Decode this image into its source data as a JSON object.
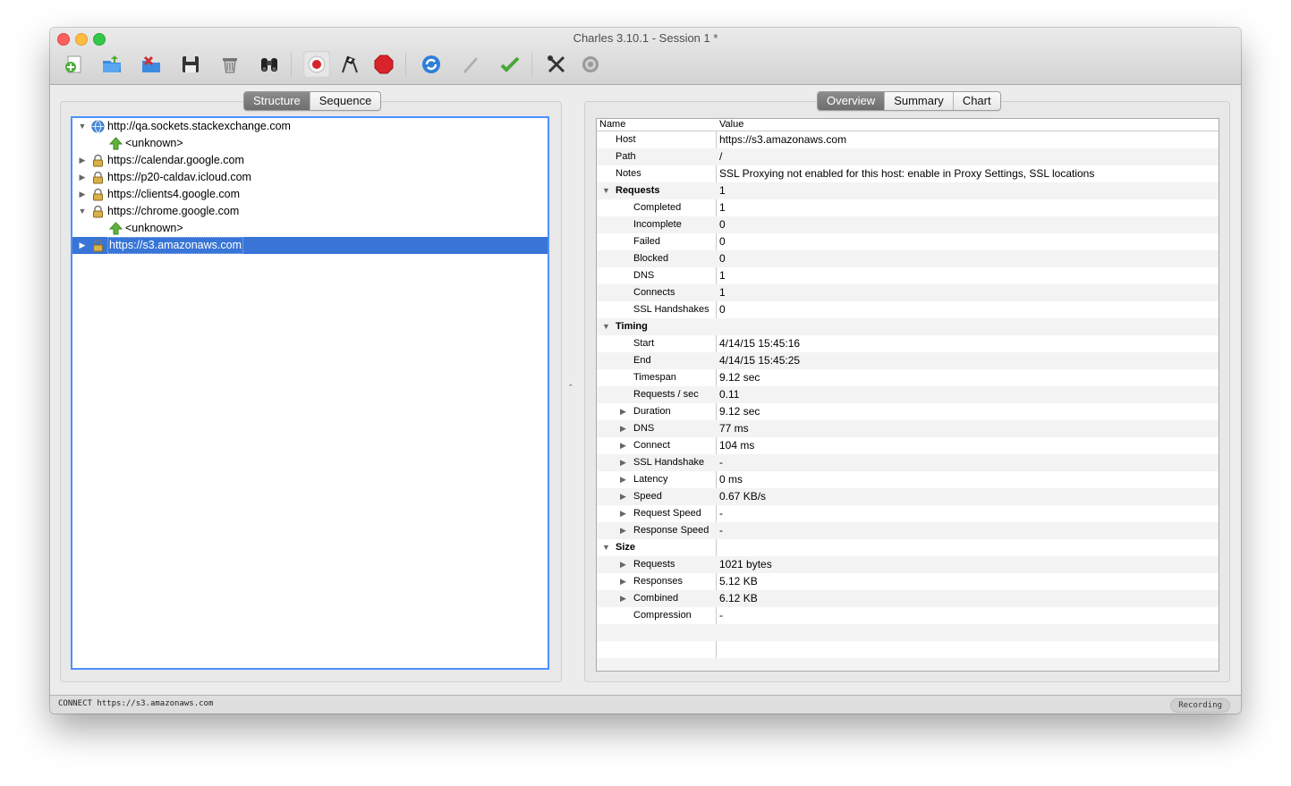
{
  "window": {
    "title": "Charles 3.10.1 - Session 1 *"
  },
  "toolbar": {
    "buttons": [
      {
        "name": "new-session",
        "icon": "new-session-icon"
      },
      {
        "name": "open-session",
        "icon": "open-folder-icon"
      },
      {
        "name": "close-session",
        "icon": "close-session-icon"
      },
      {
        "name": "save",
        "icon": "floppy-disk-icon"
      },
      {
        "name": "clear",
        "icon": "trash-icon"
      },
      {
        "name": "find",
        "icon": "binoculars-icon"
      },
      {
        "name": "record",
        "icon": "record-icon"
      },
      {
        "name": "throttle",
        "icon": "checkered-flags-icon"
      },
      {
        "name": "breakpoints",
        "icon": "stop-sign-icon"
      },
      {
        "name": "repeat",
        "icon": "refresh-icon"
      },
      {
        "name": "edit",
        "icon": "pencil-icon"
      },
      {
        "name": "validate",
        "icon": "checkmark-icon"
      },
      {
        "name": "tools",
        "icon": "tools-icon"
      },
      {
        "name": "settings",
        "icon": "gear-icon"
      }
    ]
  },
  "left_tabs": [
    {
      "label": "Structure",
      "selected": true
    },
    {
      "label": "Sequence",
      "selected": false
    }
  ],
  "right_tabs": [
    {
      "label": "Overview",
      "selected": true
    },
    {
      "label": "Summary",
      "selected": false
    },
    {
      "label": "Chart",
      "selected": false
    }
  ],
  "tree": [
    {
      "label": "http://qa.sockets.stackexchange.com",
      "icon": "globe-icon",
      "expanded": true,
      "level": 0
    },
    {
      "label": "<unknown>",
      "icon": "upload-arrow-icon",
      "level": 1
    },
    {
      "label": "https://calendar.google.com",
      "icon": "lock-icon",
      "expanded": false,
      "level": 0
    },
    {
      "label": "https://p20-caldav.icloud.com",
      "icon": "lock-icon",
      "expanded": false,
      "level": 0
    },
    {
      "label": "https://clients4.google.com",
      "icon": "lock-icon",
      "expanded": false,
      "level": 0
    },
    {
      "label": "https://chrome.google.com",
      "icon": "lock-icon",
      "expanded": true,
      "level": 0
    },
    {
      "label": "<unknown>",
      "icon": "upload-arrow-icon",
      "level": 1
    },
    {
      "label": "https://s3.amazonaws.com",
      "icon": "lock-icon",
      "expanded": false,
      "level": 0,
      "selected": true
    }
  ],
  "overview": {
    "headers": {
      "name": "Name",
      "value": "Value"
    },
    "rows": [
      {
        "name": "Host",
        "value": "https://s3.amazonaws.com",
        "level": 0
      },
      {
        "name": "Path",
        "value": "/",
        "level": 0
      },
      {
        "name": "Notes",
        "value": "SSL Proxying not enabled for this host: enable in Proxy Settings, SSL locations",
        "level": 0
      },
      {
        "name": "Requests",
        "value": "1",
        "level": 0,
        "group": true,
        "expanded": true
      },
      {
        "name": "Completed",
        "value": "1",
        "level": 1
      },
      {
        "name": "Incomplete",
        "value": "0",
        "level": 1
      },
      {
        "name": "Failed",
        "value": "0",
        "level": 1
      },
      {
        "name": "Blocked",
        "value": "0",
        "level": 1
      },
      {
        "name": "DNS",
        "value": "1",
        "level": 1
      },
      {
        "name": "Connects",
        "value": "1",
        "level": 1
      },
      {
        "name": "SSL Handshakes",
        "value": "0",
        "level": 1
      },
      {
        "name": "Timing",
        "value": "",
        "level": 0,
        "group": true,
        "expanded": true
      },
      {
        "name": "Start",
        "value": "4/14/15 15:45:16",
        "level": 1
      },
      {
        "name": "End",
        "value": "4/14/15 15:45:25",
        "level": 1
      },
      {
        "name": "Timespan",
        "value": "9.12 sec",
        "level": 1
      },
      {
        "name": "Requests / sec",
        "value": "0.11",
        "level": 1
      },
      {
        "name": "Duration",
        "value": "9.12 sec",
        "level": 1,
        "expander": true
      },
      {
        "name": "DNS",
        "value": "77 ms",
        "level": 1,
        "expander": true
      },
      {
        "name": "Connect",
        "value": "104 ms",
        "level": 1,
        "expander": true
      },
      {
        "name": "SSL Handshake",
        "value": "-",
        "level": 1,
        "expander": true
      },
      {
        "name": "Latency",
        "value": "0 ms",
        "level": 1,
        "expander": true
      },
      {
        "name": "Speed",
        "value": "0.67 KB/s",
        "level": 1,
        "expander": true
      },
      {
        "name": "Request Speed",
        "value": "-",
        "level": 1,
        "expander": true
      },
      {
        "name": "Response Speed",
        "value": "-",
        "level": 1,
        "expander": true
      },
      {
        "name": "Size",
        "value": "",
        "level": 0,
        "group": true,
        "expanded": true
      },
      {
        "name": "Requests",
        "value": "1021 bytes",
        "level": 1,
        "expander": true
      },
      {
        "name": "Responses",
        "value": "5.12 KB",
        "level": 1,
        "expander": true
      },
      {
        "name": "Combined",
        "value": "6.12 KB",
        "level": 1,
        "expander": true
      },
      {
        "name": "Compression",
        "value": "-",
        "level": 1
      }
    ]
  },
  "statusbar": {
    "text": "CONNECT https://s3.amazonaws.com",
    "recording": "Recording"
  },
  "splitter_glyph": "ˆ"
}
